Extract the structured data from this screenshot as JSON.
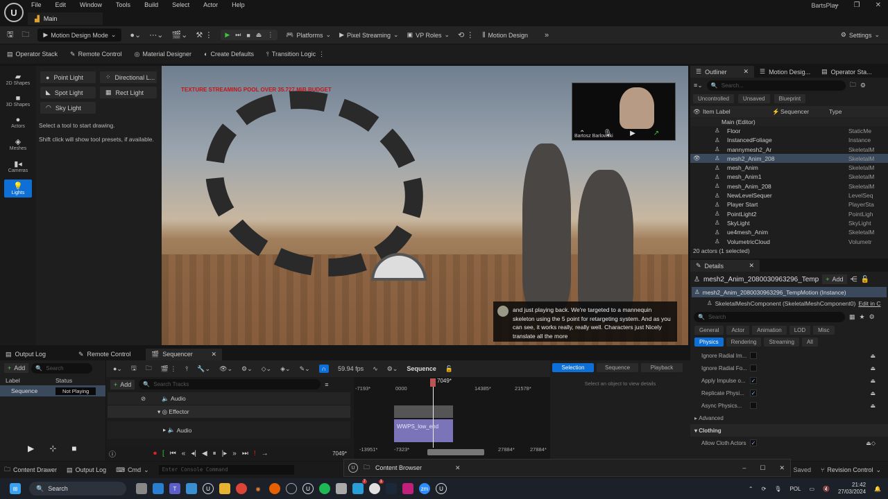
{
  "app": {
    "project": "BartsPlay",
    "level_tab": "Main",
    "menu": [
      "File",
      "Edit",
      "Window",
      "Tools",
      "Build",
      "Select",
      "Actor",
      "Help"
    ]
  },
  "toolbar": {
    "mode": "Motion Design Mode",
    "platforms": "Platforms",
    "pixel_streaming": "Pixel Streaming",
    "vp_roles": "VP Roles",
    "motion_design": "Motion Design",
    "settings": "Settings"
  },
  "toolbar2": {
    "items": [
      "Operator Stack",
      "Remote Control",
      "Material Designer",
      "Create Defaults",
      "Transition Logic"
    ]
  },
  "modes": {
    "items": [
      "2D Shapes",
      "3D Shapes",
      "Actors",
      "Meshes",
      "Cameras",
      "Lights"
    ],
    "active": "Lights"
  },
  "tools": {
    "buttons": [
      "Point Light",
      "Directional L...",
      "Spot Light",
      "Rect Light",
      "Sky Light"
    ],
    "hint1": "Select a tool to start drawing.",
    "hint2": "Shift click will show tool presets, if available."
  },
  "viewport": {
    "warning": "TEXTURE STREAMING POOL OVER 35.727 MiB BUDGET",
    "webcam_name": "Bartosz Barlowski",
    "caption": "and just playing back. We're targeted to a mannequin skeleton using the 5 point for retargeting system. And as you can see, it works really, really well. Characters just Nicely translate all the more"
  },
  "outliner": {
    "tabs": [
      "Outliner",
      "Motion Desig...",
      "Operator Sta..."
    ],
    "search_placeholder": "Search...",
    "filters": [
      "Uncontrolled",
      "Unsaved",
      "Blueprint"
    ],
    "columns": [
      "Item Label",
      "Sequencer",
      "Type"
    ],
    "root": "Main (Editor)",
    "rows": [
      {
        "label": "Floor",
        "type": "StaticMe"
      },
      {
        "label": "InstancedFoliage",
        "type": "Instance"
      },
      {
        "label": "mannymesh2_Ar",
        "type": "SkeletalM"
      },
      {
        "label": "mesh2_Anim_208",
        "type": "SkeletalM"
      },
      {
        "label": "mesh_Anim",
        "type": "SkeletalM"
      },
      {
        "label": "mesh_Anim1",
        "type": "SkeletalM"
      },
      {
        "label": "mesh_Anim_208",
        "type": "SkeletalM"
      },
      {
        "label": "NewLevelSequer",
        "type": "LevelSeq"
      },
      {
        "label": "Player Start",
        "type": "PlayerSta"
      },
      {
        "label": "PointLight2",
        "type": "PointLigh"
      },
      {
        "label": "SkyLight",
        "type": "SkyLight"
      },
      {
        "label": "ue4mesh_Anim",
        "type": "SkeletalM"
      },
      {
        "label": "VolumetricCloud",
        "type": "Volumetr"
      }
    ],
    "selected_index": 3,
    "count": "20 actors (1 selected)"
  },
  "details": {
    "tab": "Details",
    "actor": "mesh2_Anim_2080030963296_Temp",
    "add": "Add",
    "instance": "mesh2_Anim_2080030963296_TempMotion (Instance)",
    "component": "SkeletalMeshComponent (SkeletalMeshComponent0)",
    "edit_link": "Edit in C",
    "search_placeholder": "Search",
    "categories": [
      "General",
      "Actor",
      "Animation",
      "LOD",
      "Misc",
      "Physics",
      "Rendering",
      "Streaming",
      "All"
    ],
    "active_category": "Physics",
    "props": [
      {
        "label": "Ignore Radial Im...",
        "checked": false
      },
      {
        "label": "Ignore Radial Fo...",
        "checked": false
      },
      {
        "label": "Apply Impulse o...",
        "checked": true
      },
      {
        "label": "Replicate Physi...",
        "checked": true
      },
      {
        "label": "Async Physics...",
        "checked": false
      }
    ],
    "advanced": "Advanced",
    "clothing": "Clothing",
    "cloth_prop": "Allow Cloth Actors",
    "cloth_checked": true
  },
  "bottom_tabs": [
    "Output Log",
    "Remote Control",
    "Sequencer"
  ],
  "sequence_list": {
    "add": "Add",
    "search_placeholder": "Search",
    "columns": [
      "Label",
      "Status"
    ],
    "row": {
      "label": "Sequence",
      "status": "Not Playing"
    }
  },
  "sequencer": {
    "add": "Add",
    "search_placeholder": "Search Tracks",
    "fps": "59.94 fps",
    "title": "Sequence",
    "tracks": [
      "Audio",
      "Effector",
      "Audio"
    ],
    "clip": "WWPS_low_end",
    "current_frame": "7049*",
    "ruler": [
      "-7193*",
      "0000",
      "14385*",
      "21578*"
    ],
    "range": [
      "-13951*",
      "-7323*",
      "27884*",
      "27884*"
    ],
    "side_tabs": [
      "Selection",
      "Sequence",
      "Playback"
    ],
    "side_hint": "Select an object to view details"
  },
  "statusbar": {
    "content_drawer": "Content Drawer",
    "output_log": "Output Log",
    "cmd": "Cmd",
    "console_placeholder": "Enter Console Command",
    "saved": "Saved",
    "revision": "Revision Control"
  },
  "content_browser": {
    "title": "Content Browser"
  },
  "taskbar": {
    "search": "Search",
    "lang": "POL",
    "time": "21:42",
    "date": "27/03/2024",
    "badges": [
      "7",
      "1"
    ]
  },
  "colors": {
    "accent": "#0e6fd6",
    "warning": "#c01818",
    "clip": "#7b74b8"
  }
}
